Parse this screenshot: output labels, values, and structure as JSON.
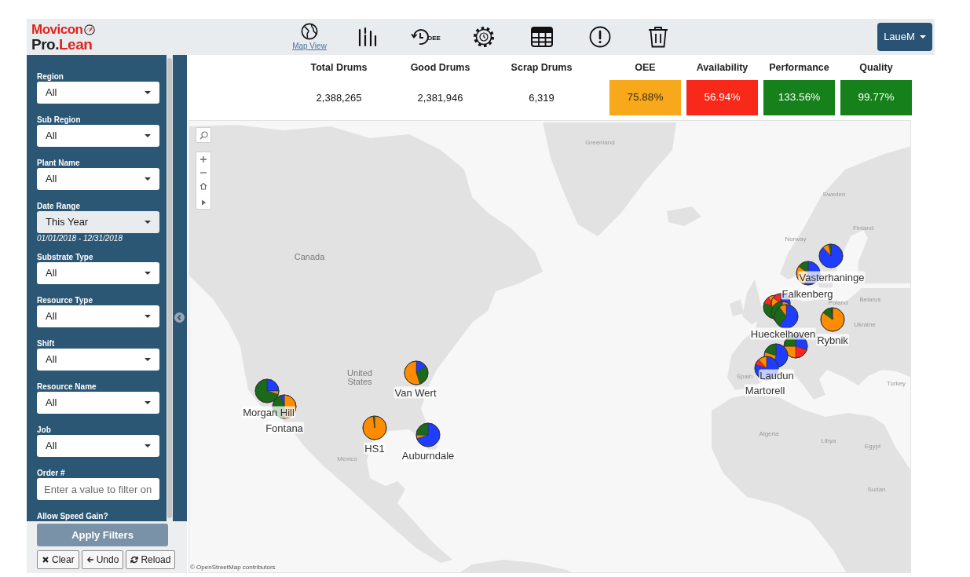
{
  "header": {
    "logo": {
      "line_1": "Movicon",
      "line_2": [
        "Pro.",
        "Lean"
      ]
    },
    "nav": [
      {
        "kind": "map",
        "label": "Map View"
      },
      {
        "kind": "bars"
      },
      {
        "kind": "history",
        "label": "OEE"
      },
      {
        "kind": "settings"
      },
      {
        "kind": "table"
      },
      {
        "kind": "alert"
      },
      {
        "kind": "trash"
      }
    ],
    "user_menu": {
      "label": "LaueM"
    }
  },
  "sidebar": {
    "filters": [
      {
        "kind": "select",
        "label": "Region",
        "value": "All"
      },
      {
        "kind": "select",
        "label": "Sub Region",
        "value": "All"
      },
      {
        "kind": "select",
        "label": "Plant Name",
        "value": "All"
      },
      {
        "kind": "date-select",
        "label": "Date Range",
        "value": "This Year",
        "note": "01/01/2018 - 12/31/2018"
      },
      {
        "kind": "select",
        "label": "Substrate Type",
        "value": "All"
      },
      {
        "kind": "select",
        "label": "Resource Type",
        "value": "All"
      },
      {
        "kind": "select",
        "label": "Shift",
        "value": "All"
      },
      {
        "kind": "select",
        "label": "Resource Name",
        "value": "All"
      },
      {
        "kind": "select",
        "label": "Job",
        "value": "All"
      },
      {
        "kind": "input",
        "label": "Order #",
        "placeholder": "Enter a value to filter on"
      },
      {
        "kind": "heading",
        "label": "Allow Speed Gain?"
      }
    ],
    "apply_button": "Apply Filters",
    "actions": [
      {
        "kind": "clear",
        "label": "Clear"
      },
      {
        "kind": "undo",
        "label": "Undo"
      },
      {
        "kind": "reload",
        "label": "Reload"
      }
    ]
  },
  "summary": {
    "counts": [
      {
        "label": "Total Drums",
        "value": "2,388,265"
      },
      {
        "label": "Good Drums",
        "value": "2,381,946"
      },
      {
        "label": "Scrap Drums",
        "value": "6,319"
      }
    ],
    "metrics": [
      {
        "label": "OEE",
        "value": "75.88%",
        "color": "#f7a81b"
      },
      {
        "label": "Availability",
        "value": "56.94%",
        "color": "#f8281a"
      },
      {
        "label": "Performance",
        "value": "133.56%",
        "color": "#16801b"
      },
      {
        "label": "Quality",
        "value": "99.77%",
        "color": "#16801b"
      }
    ]
  },
  "map": {
    "place_labels": [
      "Greenland",
      "Canada",
      "United States",
      "Mexico",
      "Sweden",
      "Norway",
      "Finland",
      "Belarus",
      "Poland",
      "Ukraine",
      "Spain",
      "Turkey",
      "Algeria",
      "Libya",
      "Egypt",
      "Sudan"
    ],
    "markers": [
      {
        "label": "Morgan Hill"
      },
      {
        "label": "Fontana"
      },
      {
        "label": "Van Wert"
      },
      {
        "label": "HS1"
      },
      {
        "label": "Auburndale"
      },
      {
        "label": "Vasterhaninge"
      },
      {
        "label": "Falkenberg"
      },
      {
        "label": "Hueckelhoven"
      },
      {
        "label": "Rybnik"
      },
      {
        "label": "Laudun"
      },
      {
        "label": "Martorell"
      }
    ],
    "attribution": "© OpenStreetMap contributors"
  }
}
